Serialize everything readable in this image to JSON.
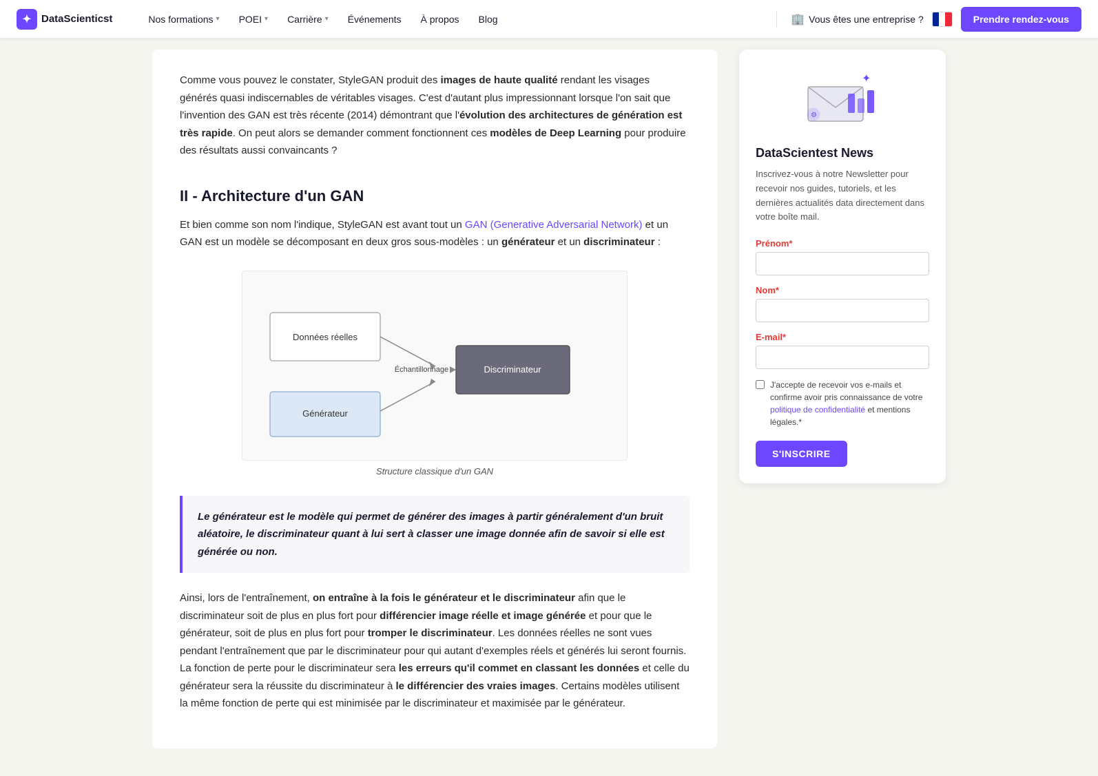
{
  "nav": {
    "logo_text": "DataScienticst",
    "logo_icon": "✦",
    "links": [
      {
        "label": "Nos formations",
        "has_dropdown": true
      },
      {
        "label": "POEI",
        "has_dropdown": true
      },
      {
        "label": "Carrière",
        "has_dropdown": true
      },
      {
        "label": "Événements",
        "has_dropdown": false
      },
      {
        "label": "À propos",
        "has_dropdown": false
      },
      {
        "label": "Blog",
        "has_dropdown": false
      }
    ],
    "enterprise_label": "Vous êtes une entreprise ?",
    "cta_label": "Prendre rendez-vous"
  },
  "content": {
    "intro": "Comme vous pouvez le constater, StyleGAN produit des ",
    "intro_bold1": "images de haute qualité",
    "intro_cont1": " rendant les visages générés quasi indiscernables de véritables visages. C'est d'autant plus impressionnant lorsque l'on sait que l'invention des GAN est très récente (2014) démontrant que l'",
    "intro_bold2": "évolution des architectures de génération est très rapide",
    "intro_cont2": ". On peut alors se demander comment fonctionnent ces ",
    "intro_bold3": "modèles de Deep Learning",
    "intro_cont3": " pour produire des résultats aussi convaincants ?",
    "section_title": "II - Architecture d'un GAN",
    "section_text1_pre": "Et bien comme son nom l'indique, StyleGAN est avant tout un ",
    "section_link": "GAN (Generative Adversarial Network)",
    "section_text1_post": " et un GAN est un modèle se décomposant en deux gros sous-modèles : un ",
    "section_bold1": "générateur",
    "section_text1_post2": " et un ",
    "section_bold2": "discriminateur",
    "section_text1_post3": " :",
    "diagram_caption": "Structure classique d'un GAN",
    "diagram": {
      "box1_label": "Données réelles",
      "box2_label": "Discriminateur",
      "box3_label": "Générateur",
      "arrow_label": "Échantillonnage"
    },
    "highlight": "Le générateur est le modèle qui permet de générer des images à partir généralement d'un bruit aléatoire, le discriminateur quant à lui sert à classer une image donnée afin de savoir si elle est générée ou non.",
    "body_text": "Ainsi, lors de l'entraînement, ",
    "body_bold1": "on entraîne à la fois le générateur et le discriminateur",
    "body_cont1": " afin que le discriminateur soit de plus en plus fort pour ",
    "body_bold2": "différencier image réelle et image générée",
    "body_cont2": " et pour que le générateur, soit de plus en plus fort pour ",
    "body_bold3": "tromper le discriminateur",
    "body_cont3": ". Les données réelles ne sont vues pendant l'entraînement que par le discriminateur pour qui autant d'exemples réels et générés lui seront fournis. La fonction de perte pour le discriminateur sera ",
    "body_bold4": "les erreurs qu'il commet en classant les données",
    "body_cont4": " et celle du générateur sera la réussite du discriminateur à ",
    "body_bold5": "le différencier des vraies images",
    "body_cont5": ". Certains modèles utilisent la même fonction de perte qui est minimisée par le discriminateur et maximisée par le générateur."
  },
  "sidebar": {
    "title": "DataScientest News",
    "description": "Inscrivez-vous à notre Newsletter pour recevoir nos guides, tutoriels, et les dernières actualités data directement dans votre boîte mail.",
    "fields": {
      "prenom_label": "Prénom",
      "nom_label": "Nom",
      "email_label": "E-mail"
    },
    "checkbox_text": "J'accepte de recevoir vos e-mails et confirme avoir pris connaissance de votre politique de confidentialité et mentions légales.",
    "submit_label": "S'INSCRIRE"
  }
}
